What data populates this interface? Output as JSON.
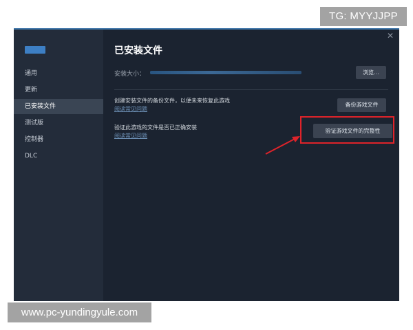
{
  "watermarks": {
    "top": "TG: MYYJJPP",
    "bottom": "www.pc-yundingyule.com"
  },
  "sidebar": {
    "items": [
      {
        "label": "通用",
        "active": false
      },
      {
        "label": "更新",
        "active": false
      },
      {
        "label": "已安装文件",
        "active": true
      },
      {
        "label": "测试版",
        "active": false
      },
      {
        "label": "控制器",
        "active": false
      },
      {
        "label": "DLC",
        "active": false
      }
    ]
  },
  "main": {
    "title": "已安装文件",
    "install_size_label": "安装大小：",
    "browse_button": "浏览…",
    "backup": {
      "description": "创建安装文件的备份文件，以便未来恢复此游戏",
      "link": "阅读常见问题",
      "button": "备份游戏文件"
    },
    "verify": {
      "description": "验证此游戏的文件是否已正确安装",
      "link": "阅读常见问题",
      "button": "验证游戏文件的完整性"
    }
  },
  "colors": {
    "highlight": "#e0232a",
    "accent": "#3d7fc4"
  }
}
